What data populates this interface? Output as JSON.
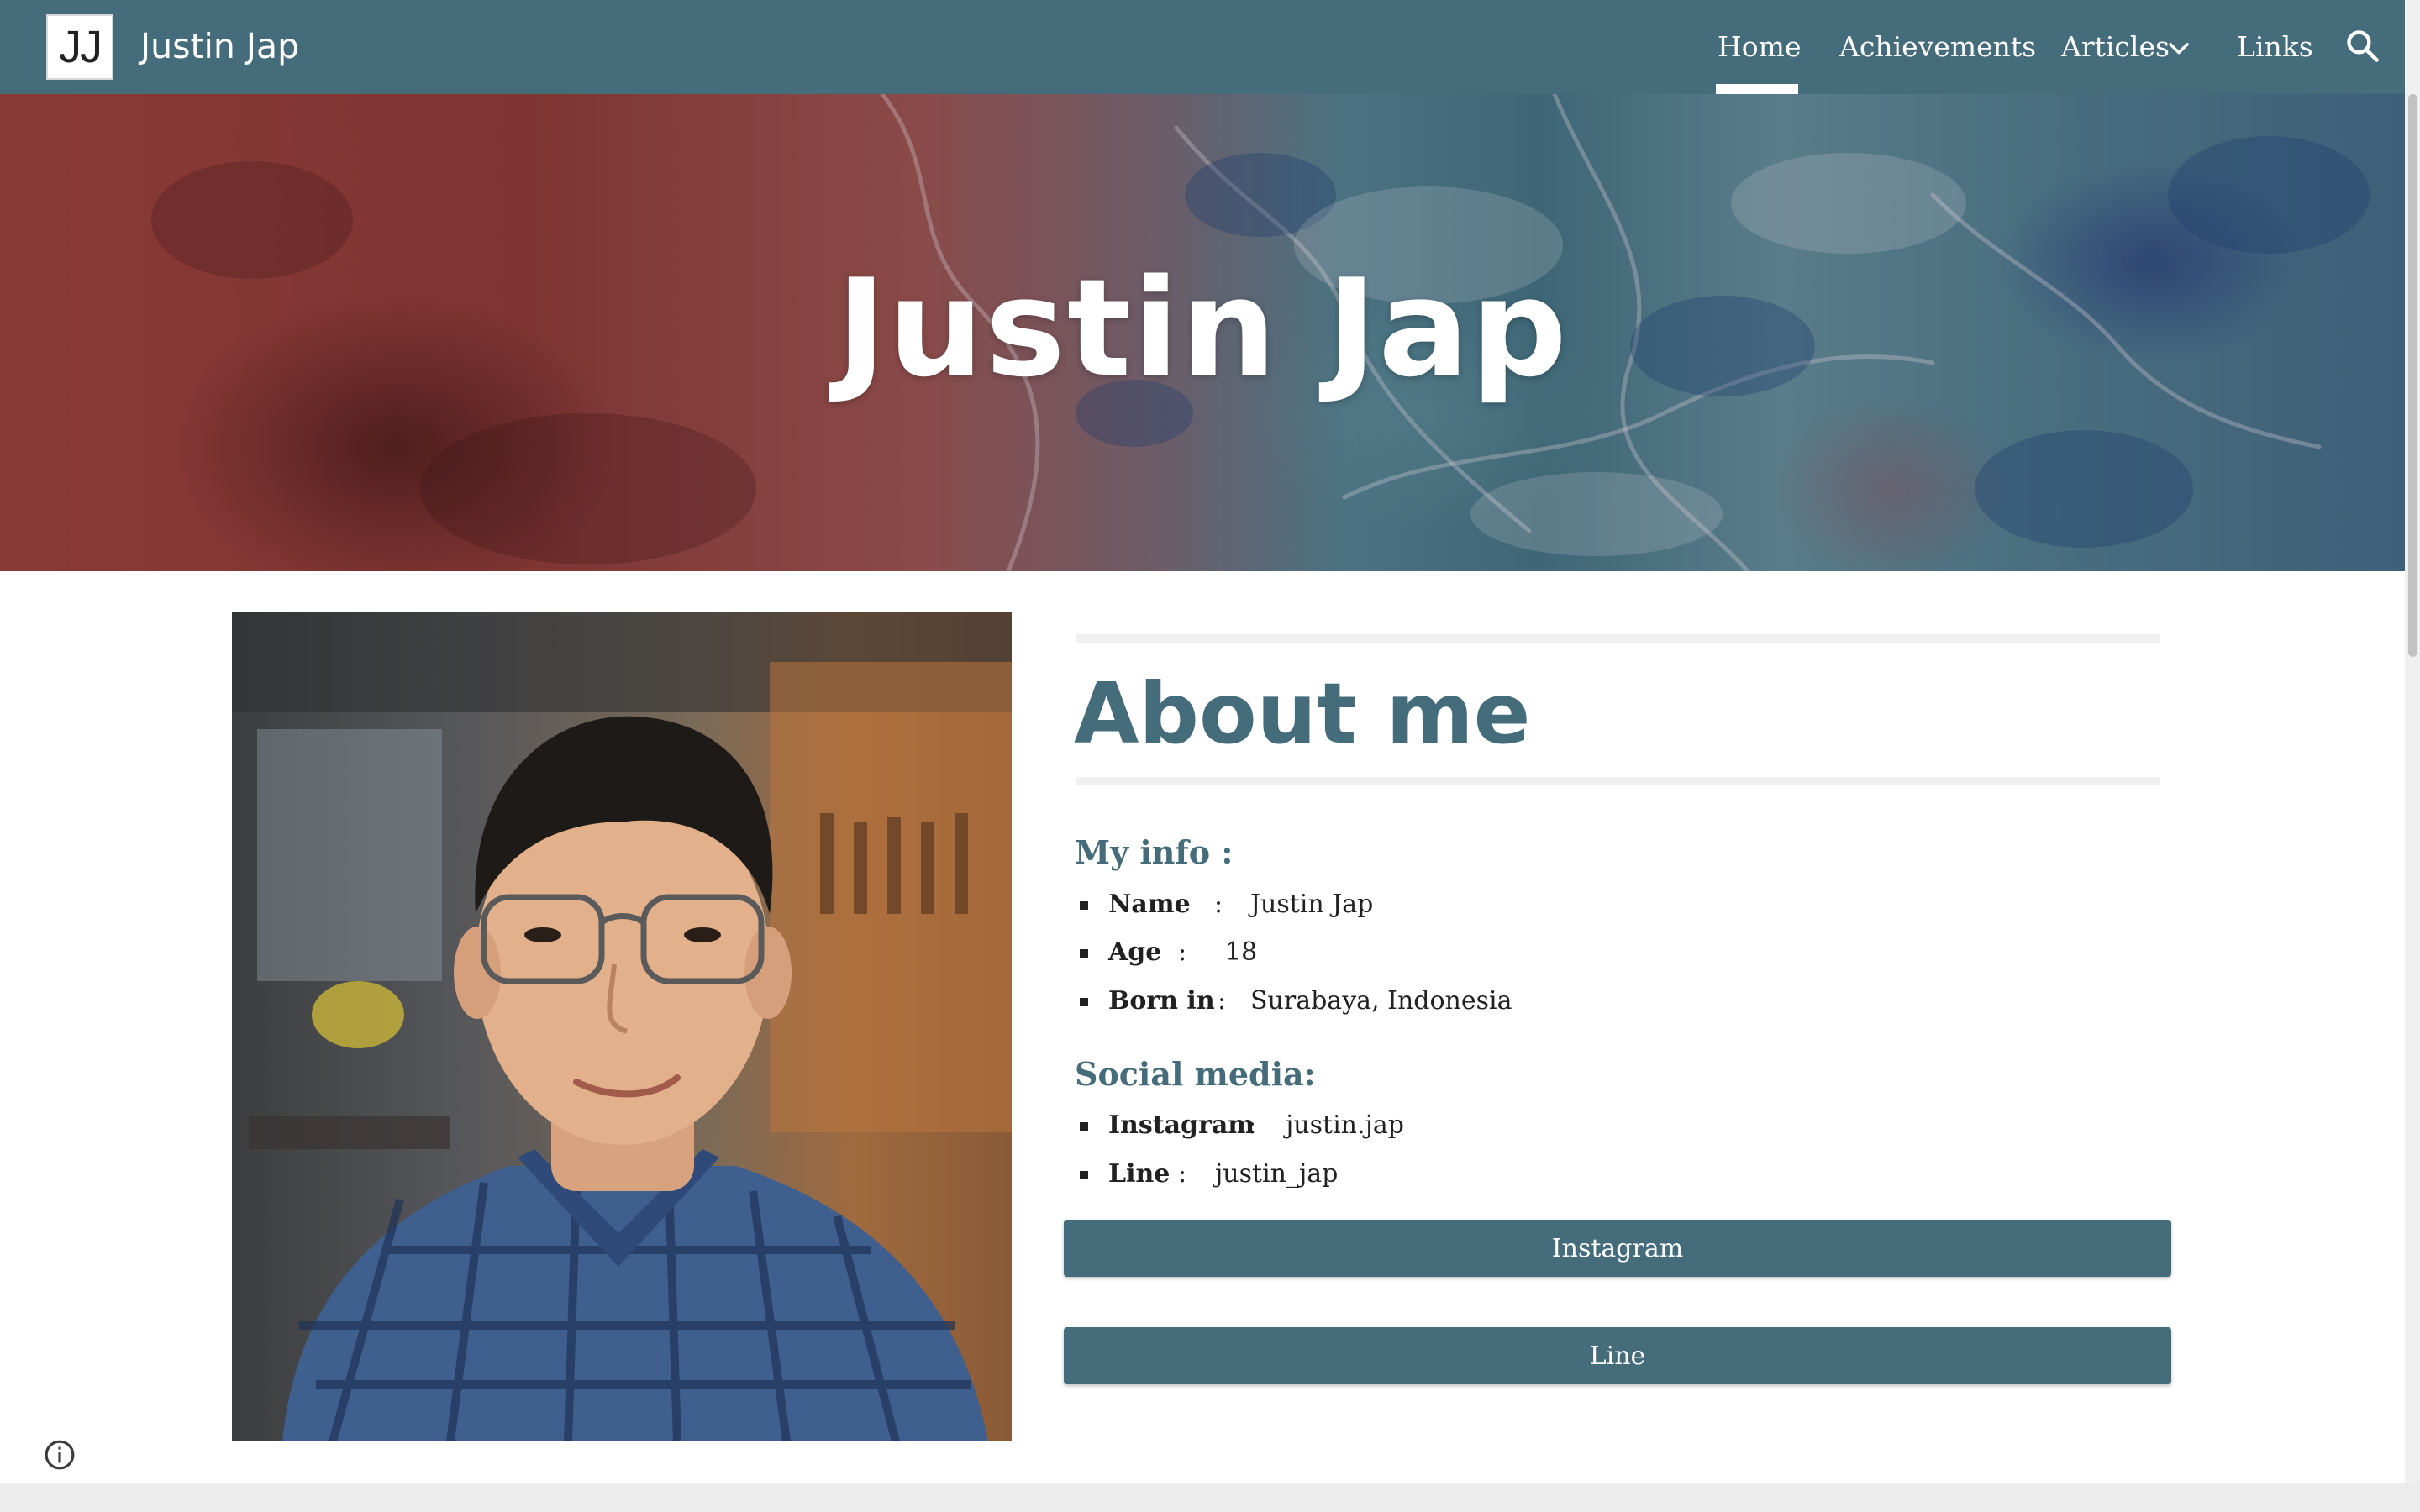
{
  "header": {
    "logo_text": "JJ",
    "site_title": "Justin Jap",
    "nav": [
      {
        "label": "Home",
        "active": true
      },
      {
        "label": "Achievements",
        "active": false
      },
      {
        "label": "Articles",
        "active": false,
        "has_dropdown": true
      },
      {
        "label": "Links",
        "active": false
      }
    ],
    "icons": {
      "dropdown": "chevron-down-icon",
      "search": "search-icon"
    }
  },
  "hero": {
    "title": "Justin Jap"
  },
  "about": {
    "heading": "About me",
    "info_heading": "My info :",
    "info": [
      {
        "label": "Name",
        "colon": ":",
        "value": "Justin Jap"
      },
      {
        "label": "Age",
        "colon": ":",
        "value": "18"
      },
      {
        "label": "Born in",
        "colon": ":",
        "value": "Surabaya, Indonesia"
      }
    ],
    "social_heading": "Social media:",
    "social": [
      {
        "label": "Instagram",
        "colon": ":",
        "value": "justin.jap"
      },
      {
        "label": "Line",
        "colon": ":",
        "value": "justin_jap"
      }
    ],
    "buttons": [
      "Instagram",
      "Line"
    ]
  },
  "footer": {
    "icons": {
      "info": "info-icon"
    }
  },
  "colors": {
    "primary": "#456c7a",
    "text": "#212121",
    "white": "#ffffff",
    "rule": "#f0f0f0"
  }
}
